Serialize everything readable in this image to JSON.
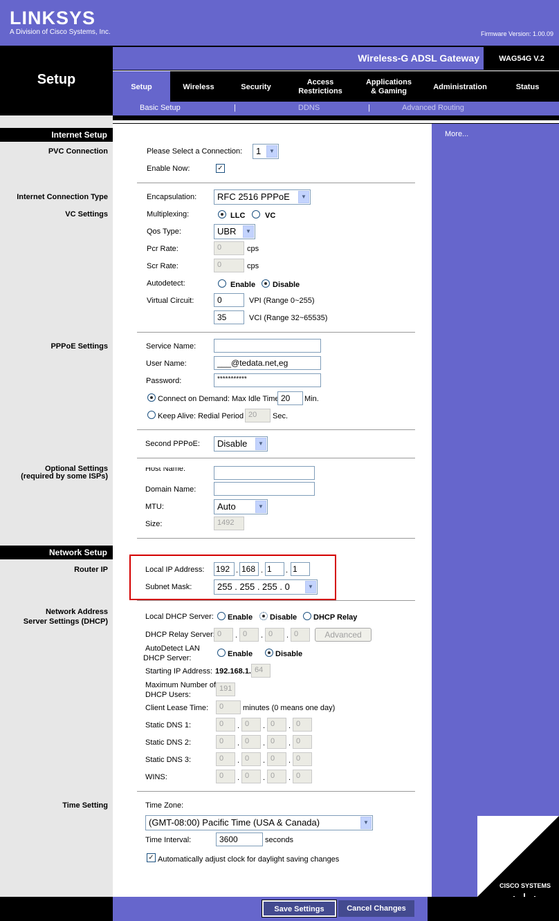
{
  "header": {
    "logo": "LINKSYS",
    "logo_sub": "A Division of Cisco Systems, Inc.",
    "firmware": "Firmware Version: 1.00.09",
    "product_name": "Wireless-G ADSL Gateway",
    "model": "WAG54G V.2",
    "page_title": "Setup"
  },
  "tabs": [
    {
      "label": "Setup",
      "active": true
    },
    {
      "label": "Wireless"
    },
    {
      "label": "Security"
    },
    {
      "label": "Access Restrictions"
    },
    {
      "label": "Applications & Gaming"
    },
    {
      "label": "Administration"
    },
    {
      "label": "Status"
    }
  ],
  "subnav": {
    "basic_setup": "Basic Setup",
    "sep": "|",
    "ddns": "DDNS",
    "advanced_routing": "Advanced Routing"
  },
  "right": {
    "more": "More..."
  },
  "left": {
    "internet_setup": "Internet Setup",
    "pvc_connection": "PVC Connection",
    "internet_connection_type": "Internet Connection Type",
    "vc_settings": "VC Settings",
    "pppoe_settings": "PPPoE Settings",
    "optional_settings": "Optional Settings",
    "optional_settings_2": "(required by some ISPs)",
    "network_setup": "Network Setup",
    "router_ip": "Router IP",
    "dhcp_1": "Network Address",
    "dhcp_2": "Server Settings (DHCP)",
    "time_setting": "Time Setting"
  },
  "pvc": {
    "select_label": "Please Select a Connection:",
    "select_value": "1",
    "enable_label": "Enable Now:",
    "enable_checked": true
  },
  "vc": {
    "encapsulation_label": "Encapsulation:",
    "encapsulation_value": "RFC 2516 PPPoE",
    "multiplexing_label": "Multiplexing:",
    "llc": "LLC",
    "vc": "VC",
    "qos_label": "Qos Type:",
    "qos_value": "UBR",
    "pcr_label": "Pcr Rate:",
    "pcr_value": "0",
    "scr_label": "Scr Rate:",
    "scr_value": "0",
    "cps": "cps",
    "autodetect_label": "Autodetect:",
    "enable": "Enable",
    "disable": "Disable",
    "virtual_circuit_label": "Virtual Circuit:",
    "vpi_value": "0",
    "vpi_range": "VPI (Range 0~255)",
    "vci_value": "35",
    "vci_range": "VCI (Range 32~65535)"
  },
  "pppoe": {
    "service_label": "Service Name:",
    "service_value": "",
    "user_label": "User Name:",
    "user_value": "___@tedata.net,eg",
    "password_label": "Password:",
    "password_value": "***********",
    "connect_on_demand": "Connect on Demand: Max Idle Time",
    "idle_value": "20",
    "min": "Min.",
    "keep_alive": "Keep Alive: Redial Period",
    "redial_value": "20",
    "sec": "Sec.",
    "second_label": "Second PPPoE:",
    "second_value": "Disable"
  },
  "optional": {
    "host_label": "Host Name:",
    "domain_label": "Domain Name:",
    "mtu_label": "MTU:",
    "mtu_value": "Auto",
    "size_label": "Size:",
    "size_value": "1492"
  },
  "router_ip": {
    "local_ip_label": "Local IP Address:",
    "ip": [
      "192",
      "168",
      "1",
      "1"
    ],
    "subnet_label": "Subnet Mask:",
    "subnet_value": "255 . 255 . 255 . 0"
  },
  "dhcp": {
    "server_label": "Local DHCP Server:",
    "enable": "Enable",
    "disable": "Disable",
    "relay": "DHCP Relay",
    "relay_server_label": "DHCP Relay Server:",
    "relay_ip": [
      "0",
      "0",
      "0",
      "0"
    ],
    "advanced": "Advanced",
    "autodetect_label_1": "AutoDetect LAN",
    "autodetect_label_2": "DHCP Server:",
    "starting_label": "Starting IP Address:",
    "starting_prefix": "192.168.1.",
    "starting_value": "64",
    "max_label_1": "Maximum Number of",
    "max_label_2": "DHCP Users:",
    "max_value": "191",
    "lease_label": "Client Lease Time:",
    "lease_value": "0",
    "lease_note": "minutes (0 means one day)",
    "dns1_label": "Static DNS 1:",
    "dns2_label": "Static DNS 2:",
    "dns3_label": "Static DNS 3:",
    "wins_label": "WINS:",
    "zero": "0",
    "dot": "."
  },
  "time": {
    "zone_label": "Time Zone:",
    "zone_value": "(GMT-08:00) Pacific Time (USA & Canada)",
    "interval_label": "Time Interval:",
    "interval_value": "3600",
    "seconds": "seconds",
    "dst_label": "Automatically adjust clock for daylight saving changes",
    "dst_checked": true
  },
  "footer": {
    "save": "Save Settings",
    "cancel": "Cancel Changes",
    "cisco": "CISCO SYSTEMS"
  },
  "colors": {
    "brand_purple": "#6666cc",
    "highlight_red": "#d40000"
  }
}
